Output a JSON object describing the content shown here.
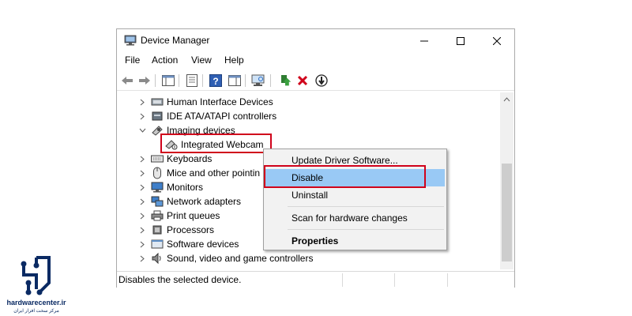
{
  "window": {
    "title": "Device Manager"
  },
  "menu": [
    "File",
    "Action",
    "View",
    "Help"
  ],
  "tree": [
    {
      "label": "Human Interface Devices",
      "expanded": false,
      "icon": "hid-icon"
    },
    {
      "label": "IDE ATA/ATAPI controllers",
      "expanded": false,
      "icon": "ide-controller-icon"
    },
    {
      "label": "Imaging devices",
      "expanded": true,
      "icon": "camera-icon"
    },
    {
      "label": "Integrated Webcam",
      "child": true,
      "icon": "webcam-icon"
    },
    {
      "label": "Keyboards",
      "expanded": false,
      "icon": "keyboard-icon"
    },
    {
      "label": "Mice and other pointin",
      "expanded": false,
      "icon": "mouse-icon"
    },
    {
      "label": "Monitors",
      "expanded": false,
      "icon": "monitor-icon"
    },
    {
      "label": "Network adapters",
      "expanded": false,
      "icon": "network-icon"
    },
    {
      "label": "Print queues",
      "expanded": false,
      "icon": "printer-icon"
    },
    {
      "label": "Processors",
      "expanded": false,
      "icon": "processor-icon"
    },
    {
      "label": "Software devices",
      "expanded": false,
      "icon": "software-icon"
    },
    {
      "label": "Sound, video and game controllers",
      "expanded": false,
      "icon": "sound-icon"
    }
  ],
  "context_menu": {
    "update": "Update Driver Software...",
    "disable": "Disable",
    "uninstall": "Uninstall",
    "scan": "Scan for hardware changes",
    "properties": "Properties"
  },
  "status": {
    "text": "Disables the selected device."
  },
  "logo": {
    "name": "hardwarecenter.ir",
    "tagline": "مرکز سخت افزار ایران"
  },
  "colors": {
    "highlight": "#99c9f5",
    "annotation": "#d0021b",
    "logo": "#0a2a63"
  }
}
